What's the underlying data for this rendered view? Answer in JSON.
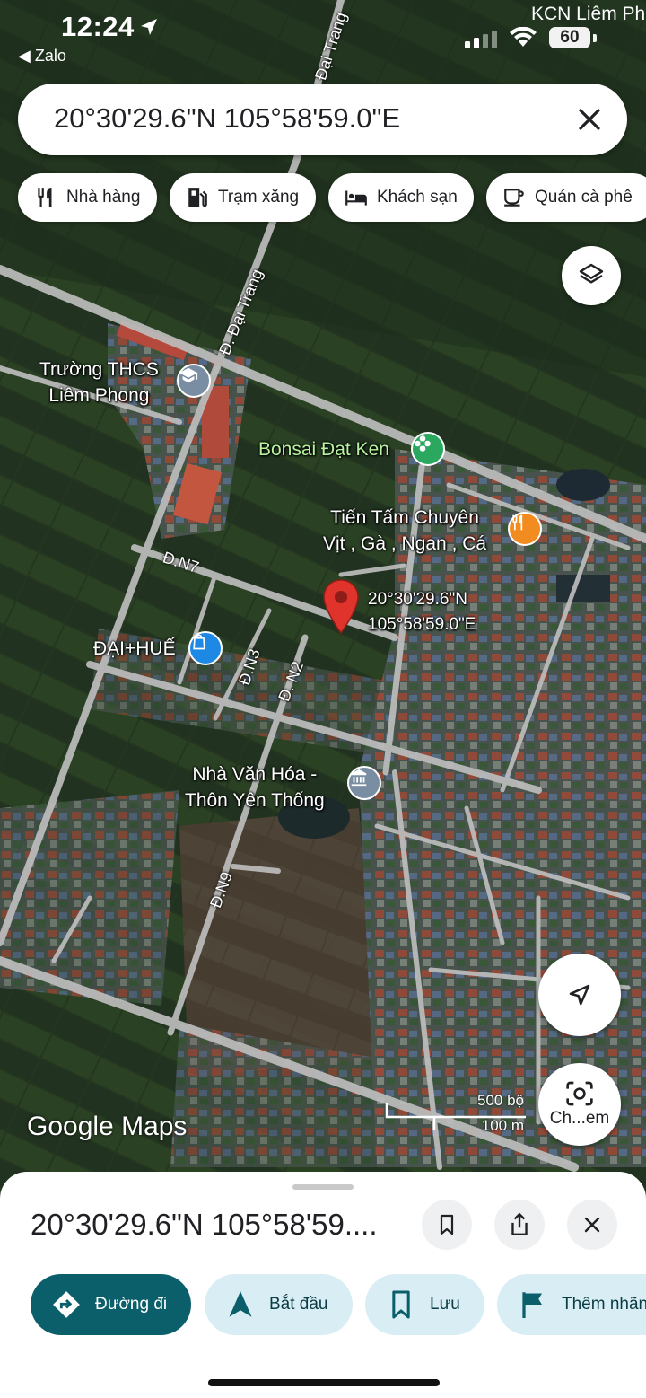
{
  "status_bar": {
    "time": "12:24",
    "back_app": "◀ Zalo",
    "area_label": "KCN Liêm Ph",
    "battery": "60"
  },
  "search": {
    "query": "20°30'29.6\"N 105°58'59.0\"E",
    "clear_icon": "close-icon"
  },
  "chips": [
    {
      "label": "Nhà hàng",
      "icon": "restaurant-icon"
    },
    {
      "label": "Trạm xăng",
      "icon": "gas-station-icon"
    },
    {
      "label": "Khách sạn",
      "icon": "hotel-icon"
    },
    {
      "label": "Quán cà phê",
      "icon": "coffee-icon"
    }
  ],
  "map": {
    "labels": {
      "school": "Trường THCS\nLiêm Phong",
      "bonsai": "Bonsai Đạt Ken",
      "restaurant": "Tiến Tấm Chuyên\nVịt , Gà , Ngan , Cá",
      "shop": "ĐẠI+HUẾ",
      "culture_house": "Nhà Văn Hóa -\nThôn Yên Thống",
      "pin_coords": "20°30'29.6\"N\n105°58'59.0\"E"
    },
    "roads": {
      "dai_trang_top": "Đ. Đại Trang",
      "dai_trang": "Đ. Đại Trang",
      "n7": "Đ.N7",
      "n3": "Đ.N3",
      "n2": "Đ. N2",
      "n9": "Đ.N9"
    },
    "logo": "Google Maps",
    "scale_imperial": "500 bộ",
    "scale_metric": "100 m",
    "image_search_label": "Ch...em",
    "colors": {
      "pin": "#e0332b",
      "poi_school": "#7a8ea3",
      "poi_bonsai": "#2aa860",
      "poi_restaurant": "#f28b20",
      "poi_shop": "#1e88e5",
      "poi_culture": "#7a8ea3"
    }
  },
  "sheet": {
    "title": "20°30'29.6\"N 105°58'59....",
    "actions": [
      {
        "label": "Đường đi",
        "icon": "directions-icon",
        "primary": true
      },
      {
        "label": "Bắt đầu",
        "icon": "navigation-arrow-icon"
      },
      {
        "label": "Lưu",
        "icon": "bookmark-icon"
      },
      {
        "label": "Thêm nhãn",
        "icon": "flag-icon"
      }
    ],
    "colors": {
      "primary": "#0b5f6b",
      "secondary_bg": "#d8eef4",
      "icon": "#0b5f6b"
    }
  }
}
